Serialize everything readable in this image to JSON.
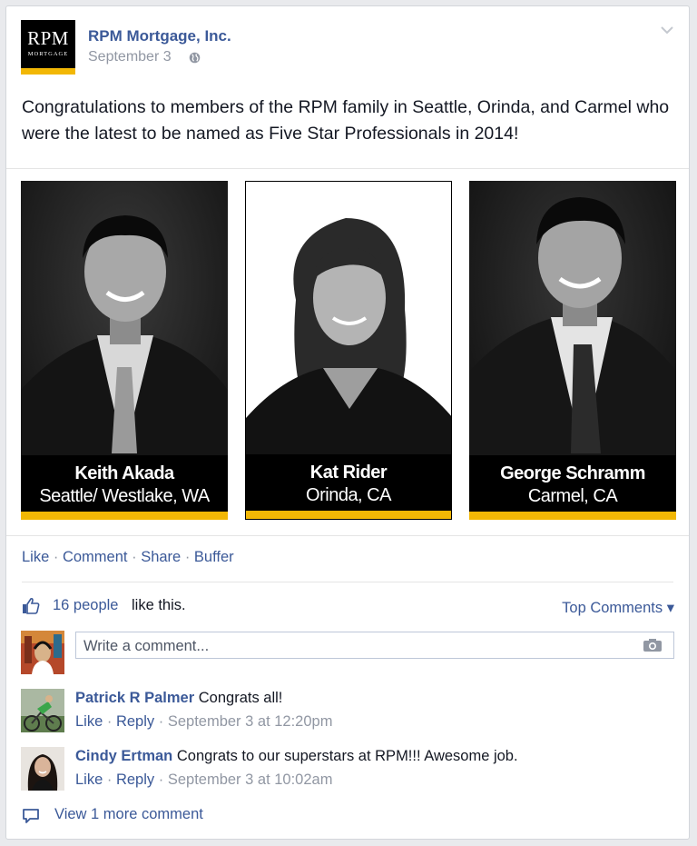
{
  "post": {
    "page_name": "RPM Mortgage, Inc.",
    "logo": {
      "line1": "RPM",
      "line2": "MORTGAGE"
    },
    "date": "September 3",
    "text": "Congratulations to members of the RPM family in Seattle, Orinda, and Carmel who were the latest to be named as Five Star Professionals in 2014!"
  },
  "photo": {
    "people": [
      {
        "name": "Keith Akada",
        "location": "Seattle/ Westlake, WA"
      },
      {
        "name": "Kat Rider",
        "location": "Orinda, CA"
      },
      {
        "name": "George Schramm",
        "location": "Carmel, CA"
      }
    ],
    "accent_color": "#f2b705"
  },
  "actions": {
    "like": "Like",
    "comment": "Comment",
    "share": "Share",
    "buffer": "Buffer",
    "separator": "·"
  },
  "likes": {
    "count": "16 people",
    "suffix": "like this."
  },
  "top_comments": "Top Comments",
  "comment_input": {
    "placeholder": "Write a comment..."
  },
  "comments": [
    {
      "author": "Patrick R Palmer",
      "text": "Congrats all!",
      "like": "Like",
      "reply": "Reply",
      "time": "September 3 at 12:20pm"
    },
    {
      "author": "Cindy Ertman",
      "text": "Congrats to our superstars at RPM!!! Awesome job.",
      "like": "Like",
      "reply": "Reply",
      "time": "September 3 at 10:02am"
    }
  ],
  "view_more": "View 1 more comment",
  "colors": {
    "link": "#3b5998",
    "muted": "#9197a3",
    "text": "#141823"
  }
}
